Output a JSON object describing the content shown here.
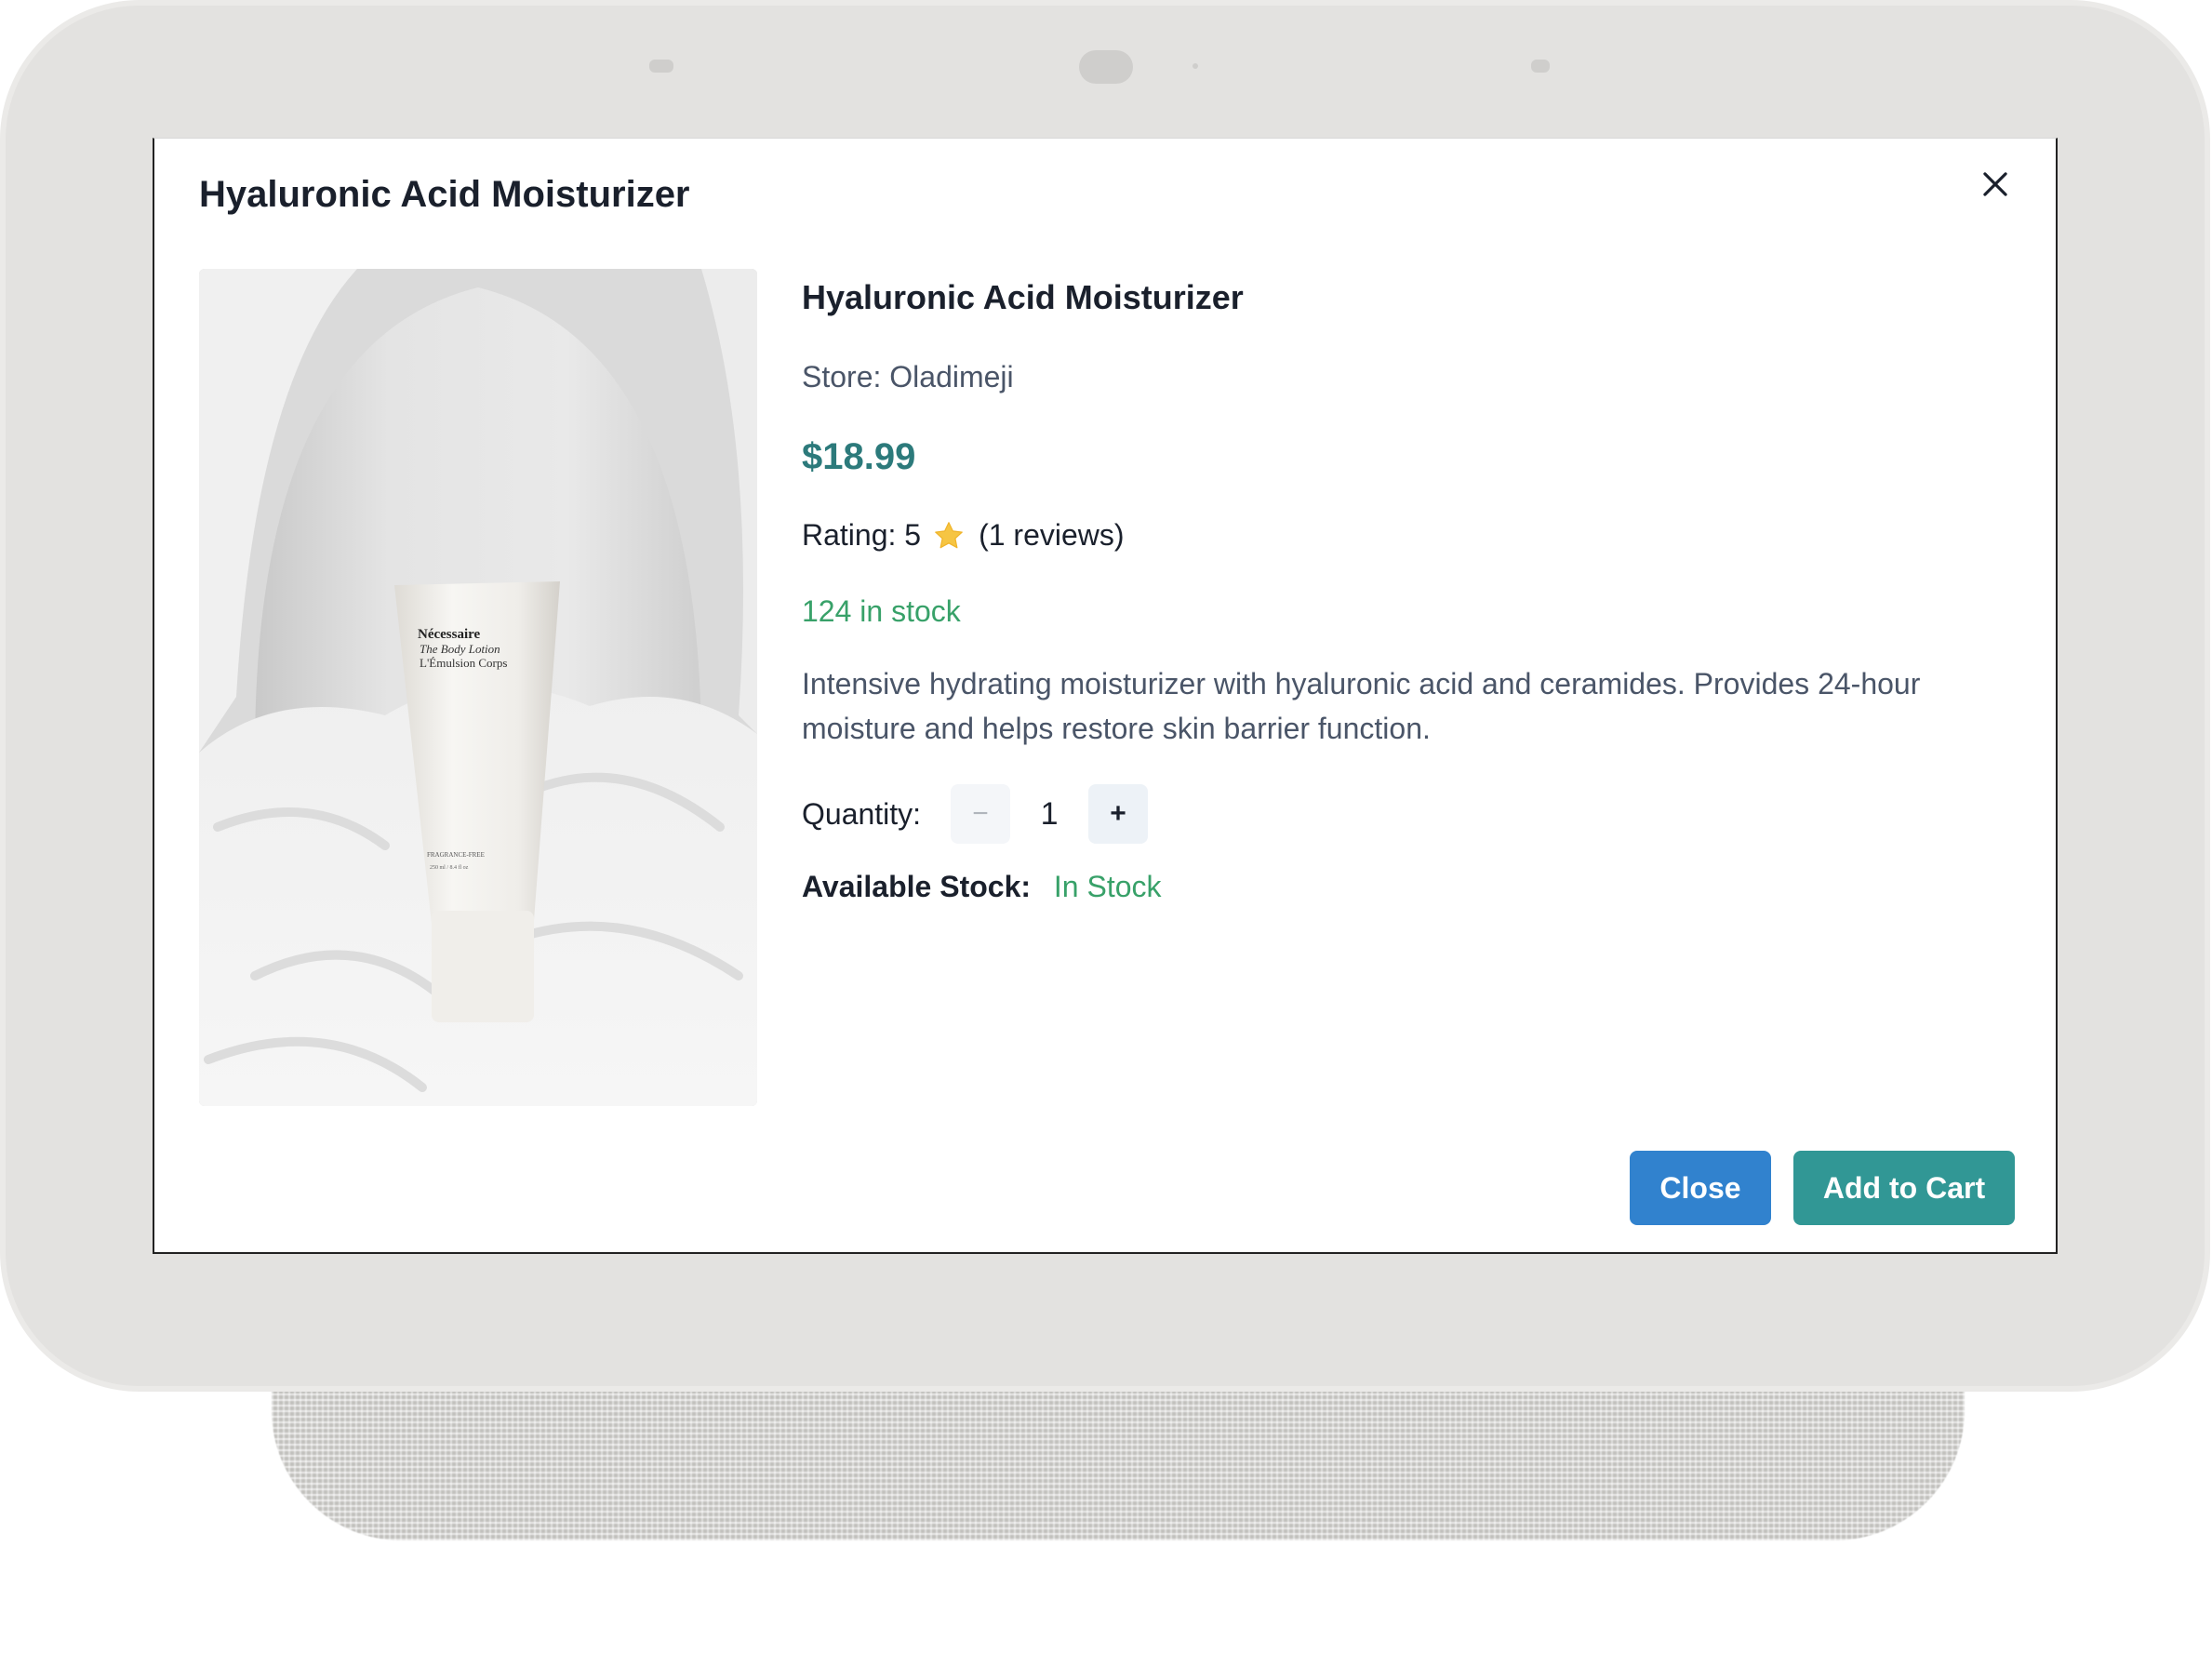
{
  "modal": {
    "title": "Hyaluronic Acid Moisturizer"
  },
  "product": {
    "name": "Hyaluronic Acid Moisturizer",
    "store": "Store: Oladimeji",
    "price": "$18.99",
    "rating_label": "Rating: 5",
    "rating_reviews": "(1 reviews)",
    "stock": "124 in stock",
    "description": "Intensive hydrating moisturizer with hyaluronic acid and ceramides. Provides 24-hour moisture and helps restore skin barrier function.",
    "image": {
      "brand": "Nécessaire",
      "line1": "The Body Lotion",
      "line2": "L'Émulsion Corps",
      "footer": "FRAGRANCE-FREE",
      "volume": "250 ml / 8.4 fl oz"
    }
  },
  "quantity": {
    "label": "Quantity:",
    "value": "1",
    "decrement": "−",
    "increment": "+"
  },
  "availability": {
    "label": "Available Stock:",
    "value": "In Stock"
  },
  "actions": {
    "close_label": "Close",
    "add_to_cart_label": "Add to Cart"
  },
  "colors": {
    "price": "#2c7a7b",
    "stock_green": "#38a169",
    "close_button": "#3182ce",
    "cart_button": "#319795",
    "star": "#f6c543"
  }
}
